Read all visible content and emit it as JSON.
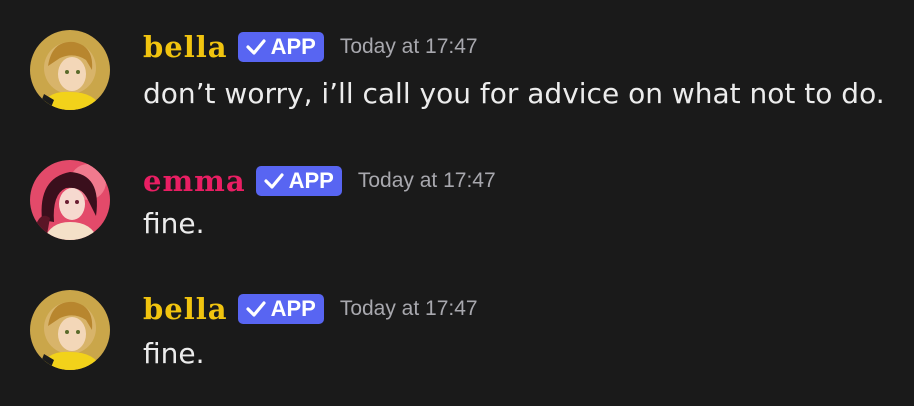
{
  "colors": {
    "background": "#1a1a1a",
    "bella_name": "#f1c40f",
    "emma_name": "#e91e63",
    "app_badge": "#5865f2",
    "message_text": "#ececec",
    "timestamp": "#a8a8ae"
  },
  "messages": [
    {
      "author": "bella",
      "badge": "APP",
      "badge_icon": "checkmark-icon",
      "timestamp": "Today at 17:47",
      "content": "don’t worry, i’ll call you for advice on what not to do."
    },
    {
      "author": "emma",
      "badge": "APP",
      "badge_icon": "checkmark-icon",
      "timestamp": "Today at 17:47",
      "content": "fine."
    },
    {
      "author": "bella",
      "badge": "APP",
      "badge_icon": "checkmark-icon",
      "timestamp": "Today at 17:47",
      "content": "fine."
    }
  ]
}
